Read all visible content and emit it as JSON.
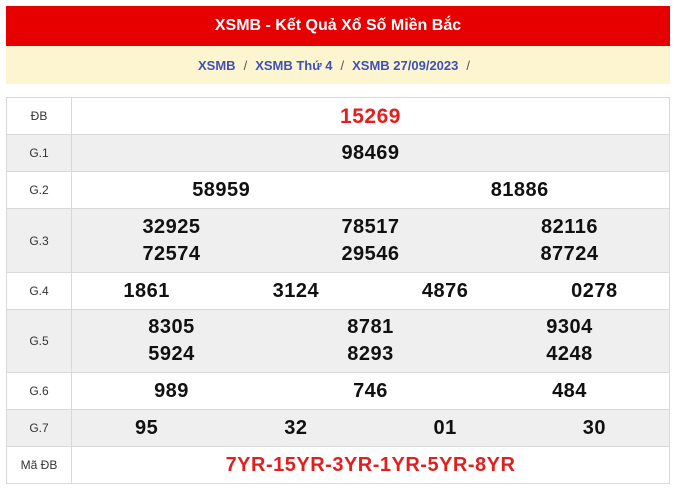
{
  "header": {
    "title": "XSMB - Kết Quả Xổ Số Miền Bắc"
  },
  "breadcrumb": {
    "items": [
      "XSMB",
      "XSMB Thứ 4",
      "XSMB 27/09/2023"
    ],
    "separator": "/"
  },
  "results": {
    "db": {
      "label": "ĐB",
      "values": [
        "15269"
      ]
    },
    "g1": {
      "label": "G.1",
      "values": [
        "98469"
      ]
    },
    "g2": {
      "label": "G.2",
      "values": [
        "58959",
        "81886"
      ]
    },
    "g3": {
      "label": "G.3",
      "values": [
        "32925",
        "78517",
        "82116",
        "72574",
        "29546",
        "87724"
      ]
    },
    "g4": {
      "label": "G.4",
      "values": [
        "1861",
        "3124",
        "4876",
        "0278"
      ]
    },
    "g5": {
      "label": "G.5",
      "values": [
        "8305",
        "8781",
        "9304",
        "5924",
        "8293",
        "4248"
      ]
    },
    "g6": {
      "label": "G.6",
      "values": [
        "989",
        "746",
        "484"
      ]
    },
    "g7": {
      "label": "G.7",
      "values": [
        "95",
        "32",
        "01",
        "30"
      ]
    },
    "madb": {
      "label": "Mã ĐB",
      "value": "7YR-15YR-3YR-1YR-5YR-8YR"
    }
  },
  "colors": {
    "header_bg": "#e60000",
    "breadcrumb_bg": "#fdf5cf",
    "link": "#3f51b5",
    "highlight": "#e01f1f",
    "alt_row": "#efefef"
  }
}
